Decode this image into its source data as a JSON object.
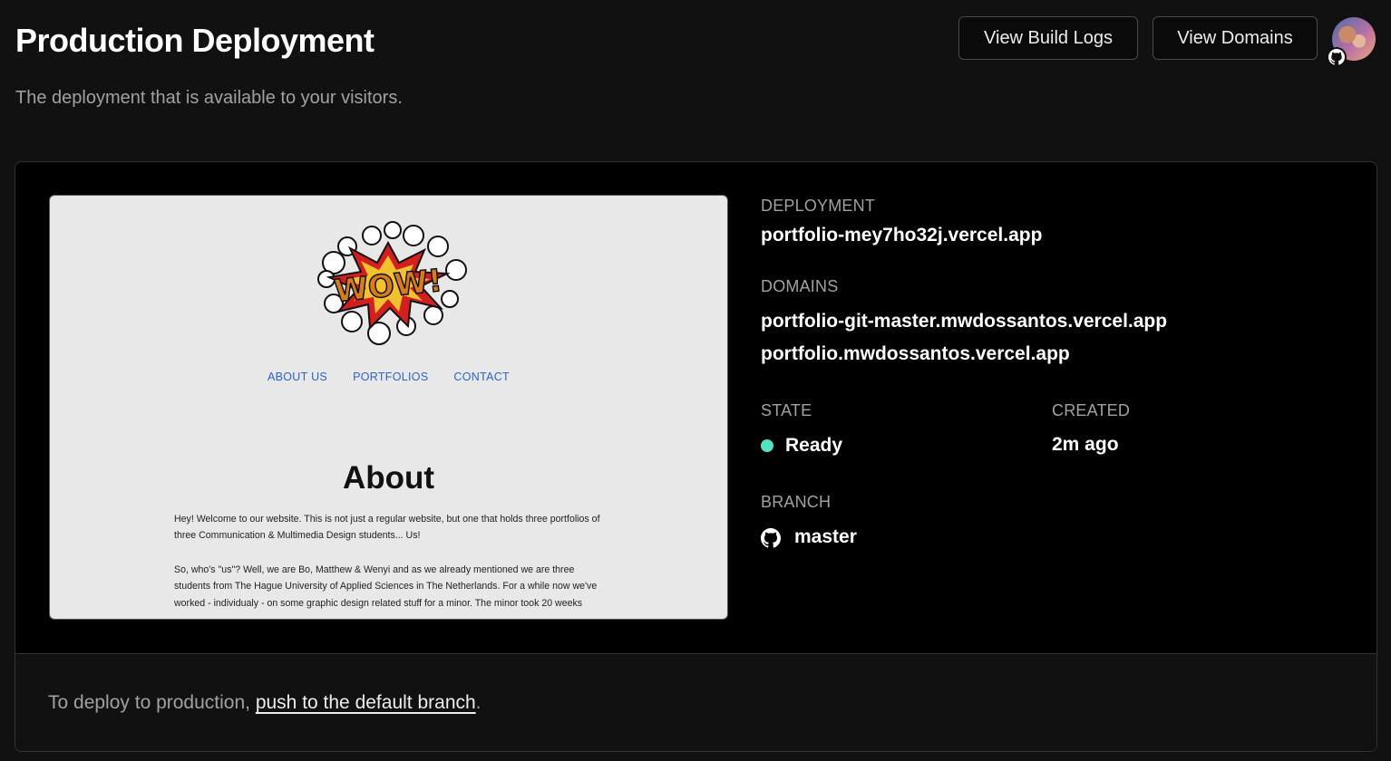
{
  "header": {
    "title": "Production Deployment",
    "subtitle": "The deployment that is available to your visitors.",
    "buttons": {
      "build_logs": "View Build Logs",
      "domains": "View Domains"
    }
  },
  "preview": {
    "nav": [
      "ABOUT US",
      "PORTFOLIOS",
      "CONTACT"
    ],
    "heading": "About",
    "paragraph1": "Hey! Welcome to our website. This is not just a regular website, but one that holds three portfolios of three Communication & Multimedia Design students... Us!",
    "paragraph2": "So, who's \"us\"? Well, we are Bo, Matthew & Wenyi and as we already mentioned we are three students from The Hague University of Applied Sciences in The Netherlands. For a while now we've worked - individualy - on some graphic design related stuff for a minor. The minor took 20 weeks"
  },
  "details": {
    "deployment_label": "DEPLOYMENT",
    "deployment_url": "portfolio-mey7ho32j.vercel.app",
    "domains_label": "DOMAINS",
    "domains": [
      "portfolio-git-master.mwdossantos.vercel.app",
      "portfolio.mwdossantos.vercel.app"
    ],
    "state_label": "STATE",
    "state_value": "Ready",
    "state_color": "#50e3c2",
    "created_label": "CREATED",
    "created_value": "2m ago",
    "branch_label": "BRANCH",
    "branch_value": "master",
    "branch_icon": "github-icon"
  },
  "footer": {
    "text_before": "To deploy to production, ",
    "link": "push to the default branch",
    "text_after": "."
  }
}
